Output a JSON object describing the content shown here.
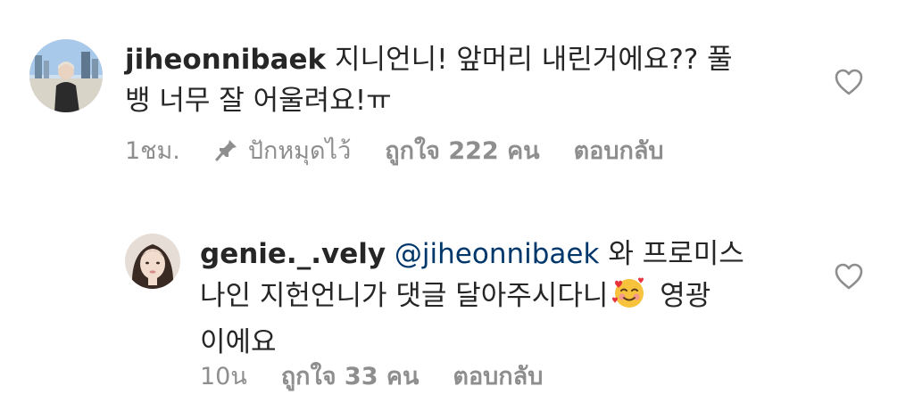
{
  "comments": [
    {
      "username": "jiheonnibaek",
      "text_line1": "지니언니! 앞머리 내린거에요?? 풀",
      "text_line2": "뱅 너무 잘 어울려요!ㅠ",
      "time": "1ชม.",
      "pinned_label": "ปักหมุดไว้",
      "likes": "ถูกใจ 222 คน",
      "reply": "ตอบกลับ",
      "avatar_icon": "avatar-photo-icon",
      "like_icon": "heart-outline-icon"
    },
    {
      "username": "genie._.vely",
      "mention": "@jiheonnibaek",
      "text_line1_rest": "와 프로미스",
      "text_line2": "나인 지헌언니가 댓글 달아주시다니",
      "text_line2_after": "영광",
      "text_line3": "이에요",
      "emoji_icon": "smiling-face-with-hearts-icon",
      "time": "10น",
      "likes": "ถูกใจ 33 คน",
      "reply": "ตอบกลับ",
      "avatar_icon": "avatar-photo-icon",
      "like_icon": "heart-outline-icon"
    }
  ],
  "colors": {
    "text": "#262626",
    "secondary": "#8e8e8e",
    "mention": "#00376b"
  }
}
